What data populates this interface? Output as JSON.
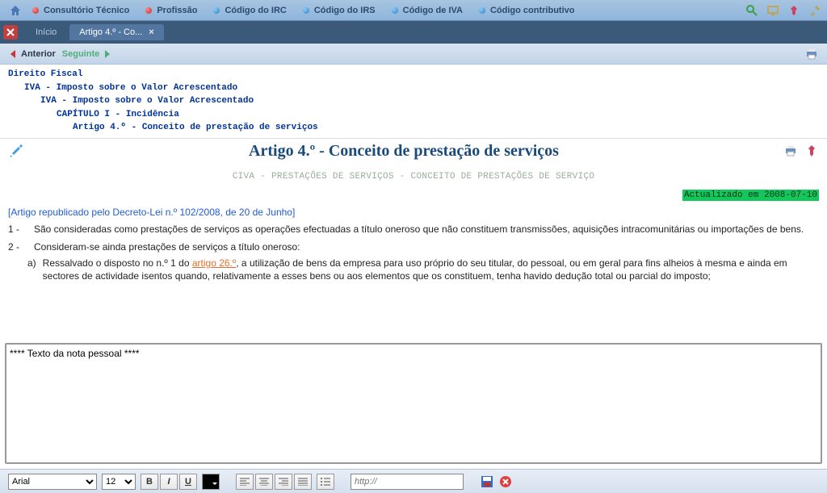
{
  "toolbar": {
    "items": [
      {
        "label": "Consultório Técnico",
        "dot": "red"
      },
      {
        "label": "Profissão",
        "dot": "red"
      },
      {
        "label": "Código do IRC",
        "dot": "blue"
      },
      {
        "label": "Código do IRS",
        "dot": "blue"
      },
      {
        "label": "Código de IVA",
        "dot": "blue"
      },
      {
        "label": "Código contributivo",
        "dot": "blue"
      }
    ]
  },
  "tabs": {
    "items": [
      {
        "label": "Início",
        "active": false
      },
      {
        "label": "Artigo 4.º - Co...",
        "active": true
      }
    ]
  },
  "nav": {
    "prev": "Anterior",
    "next": "Seguinte"
  },
  "breadcrumb": {
    "l1": "Direito Fiscal",
    "l2": "IVA - Imposto sobre o Valor Acrescentado",
    "l3": "IVA - Imposto sobre o Valor Acrescentado",
    "l4": "CAPÍTULO I - Incidência",
    "l5": "Artigo 4.º - Conceito de prestação de serviços"
  },
  "article": {
    "title": "Artigo 4.º - Conceito de prestação de serviços",
    "subtitle": "CIVA - PRESTAÇÕES DE SERVIÇOS - CONCEITO DE PRESTAÇÕES DE SERVIÇO",
    "updated": "Actualizado em 2008-07-10",
    "republished": "[Artigo republicado pelo Decreto-Lei n.º 102/2008, de 20 de Junho]",
    "para1_num": "1 -",
    "para1_text": "São consideradas como prestações de serviços as operações efectuadas a título oneroso que não constituem transmissões, aquisições intracomunitárias ou importações de bens.",
    "para2_num": "2 -",
    "para2_text": "Consideram-se ainda prestações de serviços a título oneroso:",
    "sub_a_num": "a)",
    "sub_a_pre": "Ressalvado o disposto no n.º 1 do ",
    "sub_a_link": "artigo 26.º",
    "sub_a_post": ", a utilização de bens da empresa para uso próprio do seu titular, do pessoal, ou em geral para fins alheios à mesma e ainda em sectores de actividade isentos quando, relativamente a esses bens ou aos elementos que os constituem, tenha havido dedução total ou parcial do imposto;"
  },
  "note": {
    "placeholder": "**** Texto da nota pessoal ****"
  },
  "editor": {
    "font": "Arial",
    "size": "12",
    "bold": "B",
    "italic": "I",
    "underline": "U",
    "url_placeholder": "http://"
  }
}
